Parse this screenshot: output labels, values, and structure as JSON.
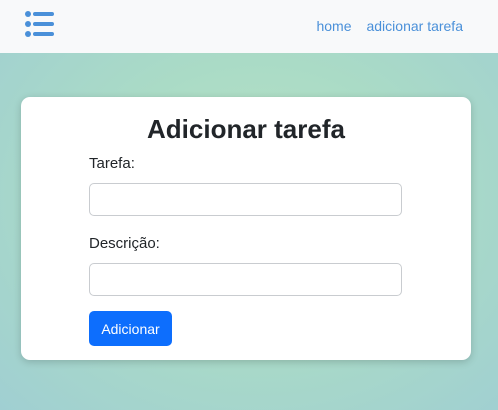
{
  "navbar": {
    "menu_icon": "list-menu-icon",
    "links": [
      "home",
      "adicionar tarefa"
    ]
  },
  "form": {
    "title": "Adicionar tarefa",
    "task_label": "Tarefa:",
    "task_value": "",
    "task_placeholder": "",
    "description_label": "Descrição:",
    "description_value": "",
    "description_placeholder": "",
    "submit_label": "Adicionar"
  },
  "colors": {
    "accent": "#0d6efd",
    "nav_link": "#4a90d9",
    "navbar_bg": "#f8f9fa"
  }
}
